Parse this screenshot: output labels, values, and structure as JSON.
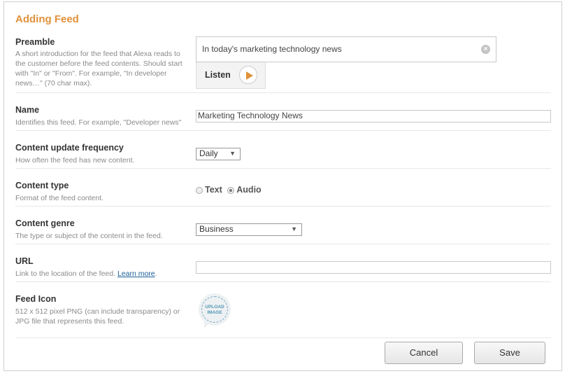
{
  "title": "Adding Feed",
  "preamble": {
    "label": "Preamble",
    "description": "A short introduction for the feed that Alexa reads to the customer before the feed contents. Should start with \"In\" or \"From\". For example, \"In developer news…\" (70 char max).",
    "value": "In today's marketing technology news",
    "listen_label": "Listen"
  },
  "name": {
    "label": "Name",
    "description": "Identifies this feed. For example, \"Developer news\"",
    "value": "Marketing Technology News"
  },
  "frequency": {
    "label": "Content update frequency",
    "description": "How often the feed has new content.",
    "selected": "Daily"
  },
  "content_type": {
    "label": "Content type",
    "description": "Format of the feed content.",
    "options": [
      "Text",
      "Audio"
    ],
    "selected": "Audio"
  },
  "genre": {
    "label": "Content genre",
    "description": "The type or subject of the content in the feed.",
    "selected": "Business"
  },
  "url": {
    "label": "URL",
    "description": "Link to the location of the feed.",
    "link_text": "Learn more",
    "value": ""
  },
  "feed_icon": {
    "label": "Feed Icon",
    "description": "512 x 512 pixel PNG (can include transparency) or JPG file that represents this feed.",
    "upload_line1": "UPLOAD",
    "upload_line2": "IMAGE"
  },
  "actions": {
    "cancel": "Cancel",
    "save": "Save"
  },
  "colors": {
    "accent": "#e0913a",
    "link": "#1a5c96"
  }
}
